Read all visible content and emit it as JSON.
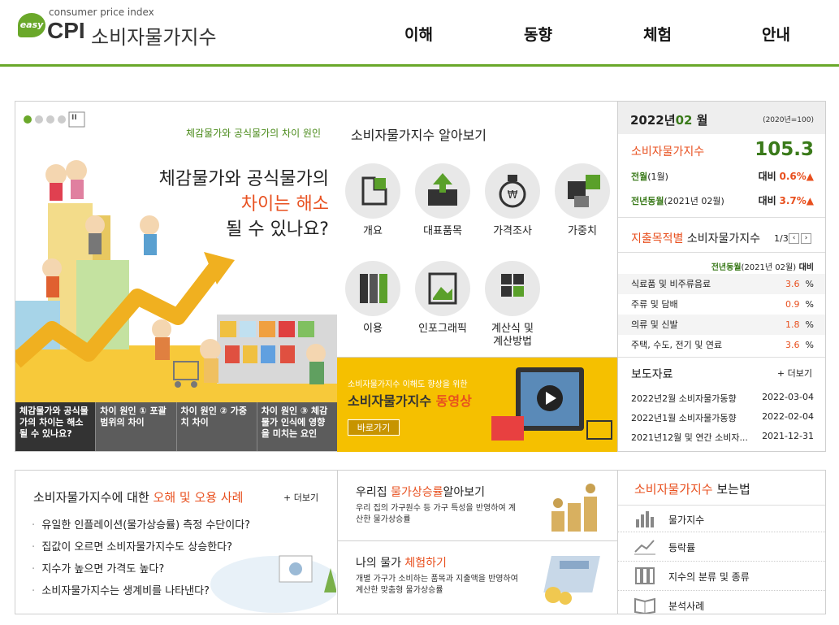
{
  "header": {
    "toplinks": "",
    "logo_badge": "easy",
    "logo_sub": "consumer price index",
    "logo_cpi": "CPI",
    "logo_name": "소비자물가지수",
    "nav": [
      "이해",
      "동향",
      "체험",
      "안내"
    ]
  },
  "hero": {
    "pause_icon": "II",
    "subtitle": "체감물가와 공식물가의 차이 원인",
    "title_line1": "체감물가와 공식물가의",
    "title_line2": "차이는 해소",
    "title_line3": "될 수 있나요?",
    "tabs": [
      "체감물가와 공식물가의 차이는 해소될 수 있나요?",
      "차이 원인 ① 포괄범위의 차이",
      "차이 원인 ② 가중치 차이",
      "차이 원인 ③ 체감물가 인식에 영향을 미치는 요인"
    ]
  },
  "about": {
    "title": "소비자물가지수 알아보기",
    "items": [
      "개요",
      "대표품목",
      "가격조사",
      "가중치",
      "이용",
      "인포그래픽",
      "계산식 및\n계산방법"
    ]
  },
  "video": {
    "small": "소비자물가지수 이해도 향상을 위한",
    "title_a": "소비자물가지수 ",
    "title_b": "동영상",
    "button": "바로가기"
  },
  "stats": {
    "year": "2022년",
    "month": "02",
    "month_suffix": "월",
    "base": "(2020년=100)",
    "cpi_label": "소비자물가지수",
    "cpi_value": "105.3",
    "mom_label": "전월",
    "mom_paren": "(1월)",
    "mom_vs": "대비",
    "mom_value": "0.6%",
    "yoy_label": "전년동월",
    "yoy_paren": "(2021년 02월)",
    "yoy_vs": "대비",
    "yoy_value": "3.7%",
    "expend_title_a": "지출목적별",
    "expend_title_b": " 소비자물가지수",
    "page": "1/3",
    "yoy_head_a": "전년동월",
    "yoy_head_b": "(2021년 02월)",
    "yoy_head_c": " 대비",
    "rows": [
      {
        "label": "식료품 및 비주류음료",
        "value": "3.6",
        "unit": "%"
      },
      {
        "label": "주류 및 담배",
        "value": "0.9",
        "unit": "%"
      },
      {
        "label": "의류 및 신발",
        "value": "1.8",
        "unit": "%"
      },
      {
        "label": "주택, 수도, 전기 및 연료",
        "value": "3.6",
        "unit": "%"
      }
    ],
    "press_title": "보도자료",
    "press_more": "+ 더보기",
    "press": [
      {
        "title": "2022년2월 소비자물가동향",
        "date": "2022-03-04"
      },
      {
        "title": "2022년1월 소비자물가동향",
        "date": "2022-02-04"
      },
      {
        "title": "2021년12월 및 연간 소비자...",
        "date": "2021-12-31"
      }
    ]
  },
  "misuse": {
    "title_a": "소비자물가지수에 대한 ",
    "title_b": "오해 및 오용 사례",
    "more": "+ 더보기",
    "items": [
      "유일한 인플레이션(물가상승률) 측정 수단이다?",
      "집값이 오르면 소비자물가지수도 상승한다?",
      "지수가 높으면 가격도 높다?",
      "소비자물가지수는 생계비를 나타낸다?"
    ]
  },
  "myhome": {
    "title_a": "우리집 ",
    "title_b": "물가상승률",
    "title_c": "알아보기",
    "desc": "우리 집의 가구원수 등 가구 특성을 반영하여 계산한 물가상승률"
  },
  "experience": {
    "title_a": "나의 물가 ",
    "title_b": "체험하기",
    "desc": "개별 가구가 소비하는 품목과 지출액을 반영하여 계산한 맞춤형 물가상승률"
  },
  "howto": {
    "title_a": "소비자물가지수",
    "title_b": " 보는법",
    "items": [
      "물가지수",
      "등락률",
      "지수의 분류 및 종류",
      "분석사례"
    ]
  },
  "colors": {
    "green": "#6aa82a",
    "red": "#e8501f",
    "yellow": "#f5c000"
  }
}
